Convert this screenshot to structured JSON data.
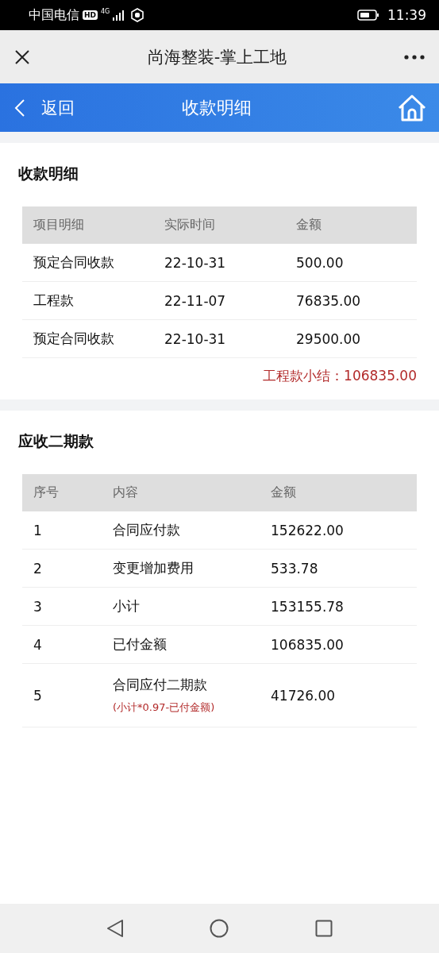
{
  "status_bar": {
    "carrier": "中国电信",
    "hd": "HD",
    "network": "4G",
    "time": "11:39"
  },
  "title_bar": {
    "title": "尚海整装-掌上工地"
  },
  "header": {
    "back": "返回",
    "title": "收款明细"
  },
  "receipts": {
    "title": "收款明细",
    "columns": [
      "项目明细",
      "实际时间",
      "金额"
    ],
    "rows": [
      [
        "预定合同收款",
        "22-10-31",
        "500.00"
      ],
      [
        "工程款",
        "22-11-07",
        "76835.00"
      ],
      [
        "预定合同收款",
        "22-10-31",
        "29500.00"
      ]
    ],
    "subtotal": "工程款小结：106835.00"
  },
  "second_payment": {
    "title": "应收二期款",
    "columns": [
      "序号",
      "内容",
      "金额"
    ],
    "rows": [
      {
        "no": "1",
        "content": "合同应付款",
        "amount": "152622.00"
      },
      {
        "no": "2",
        "content": "变更增加费用",
        "amount": "533.78"
      },
      {
        "no": "3",
        "content": "小计",
        "amount": "153155.78"
      },
      {
        "no": "4",
        "content": "已付金额",
        "amount": "106835.00"
      },
      {
        "no": "5",
        "content": "合同应付二期款",
        "note": "(小计*0.97-已付金额)",
        "amount": "41726.00"
      }
    ]
  }
}
